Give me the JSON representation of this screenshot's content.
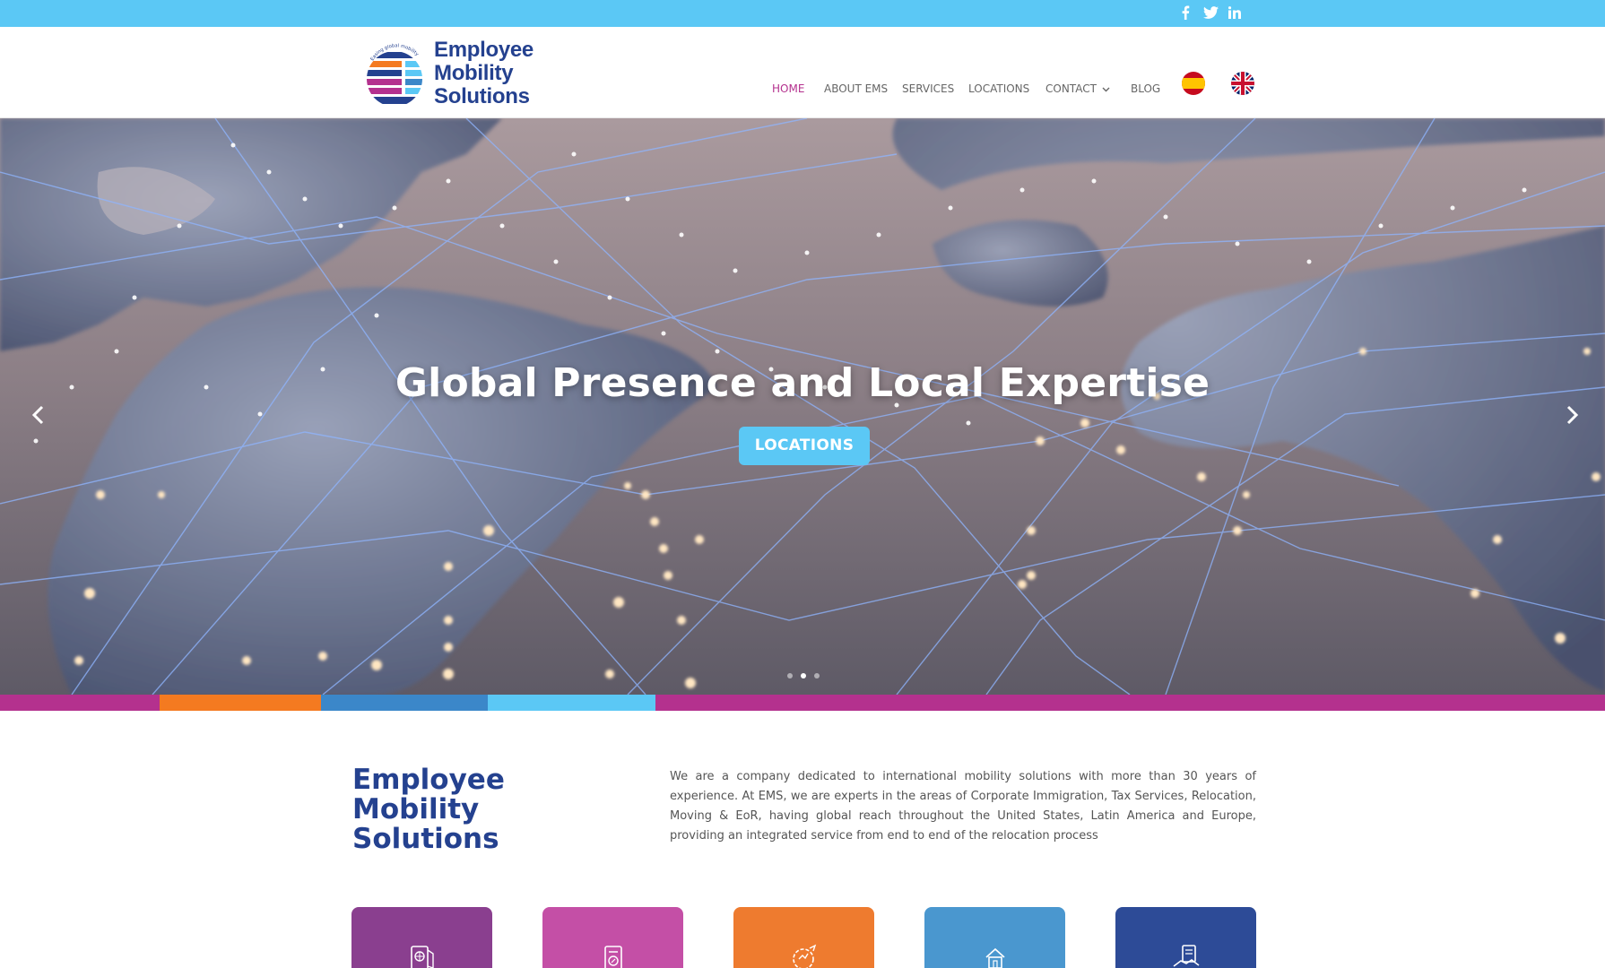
{
  "colors": {
    "topbar": "#5bc8f5",
    "brand_blue": "#24418f",
    "active_nav": "#b4318e",
    "button": "#5bc8f5"
  },
  "social": [
    {
      "icon": "facebook-icon"
    },
    {
      "icon": "twitter-icon"
    },
    {
      "icon": "linkedin-icon"
    }
  ],
  "logo": {
    "arc_text": "Easing global mobility",
    "line1": "Employee",
    "line2": "Mobility",
    "line3": "Solutions"
  },
  "nav": {
    "items": [
      {
        "label": "HOME",
        "active": true
      },
      {
        "label": "ABOUT EMS",
        "active": false
      },
      {
        "label": "SERVICES",
        "active": false
      },
      {
        "label": "LOCATIONS",
        "active": false
      },
      {
        "label": "CONTACT",
        "active": false,
        "has_dropdown": true
      },
      {
        "label": "BLOG",
        "active": false
      }
    ],
    "languages": [
      {
        "icon": "spain-flag-icon"
      },
      {
        "icon": "uk-flag-icon"
      }
    ]
  },
  "hero": {
    "title": "Global Presence and Local Expertise",
    "button_label": "LOCATIONS",
    "slide_count": 3,
    "active_slide": 2
  },
  "color_strip": [
    "#b4318e",
    "#f47a20",
    "#3b87c9",
    "#5bc8f5",
    "#b4318e"
  ],
  "intro": {
    "title_line1": "Employee",
    "title_line2": "Mobility",
    "title_line3": "Solutions",
    "text": "We are a company dedicated to international mobility solutions with more than 30 years of experience. At EMS, we are experts in the areas of Corporate Immigration, Tax Services, Relocation, Moving & EoR, having global reach throughout the United States, Latin America and Europe, providing an integrated service from end to end of the relocation process"
  },
  "service_cards": [
    {
      "icon": "passport-icon",
      "color": "#8a3f8f"
    },
    {
      "icon": "tax-document-icon",
      "color": "#c44fa6"
    },
    {
      "icon": "relocation-globe-icon",
      "color": "#ee7b2f"
    },
    {
      "icon": "house-moving-icon",
      "color": "#4a97cf"
    },
    {
      "icon": "handshake-contract-icon",
      "color": "#2d4b97"
    }
  ]
}
